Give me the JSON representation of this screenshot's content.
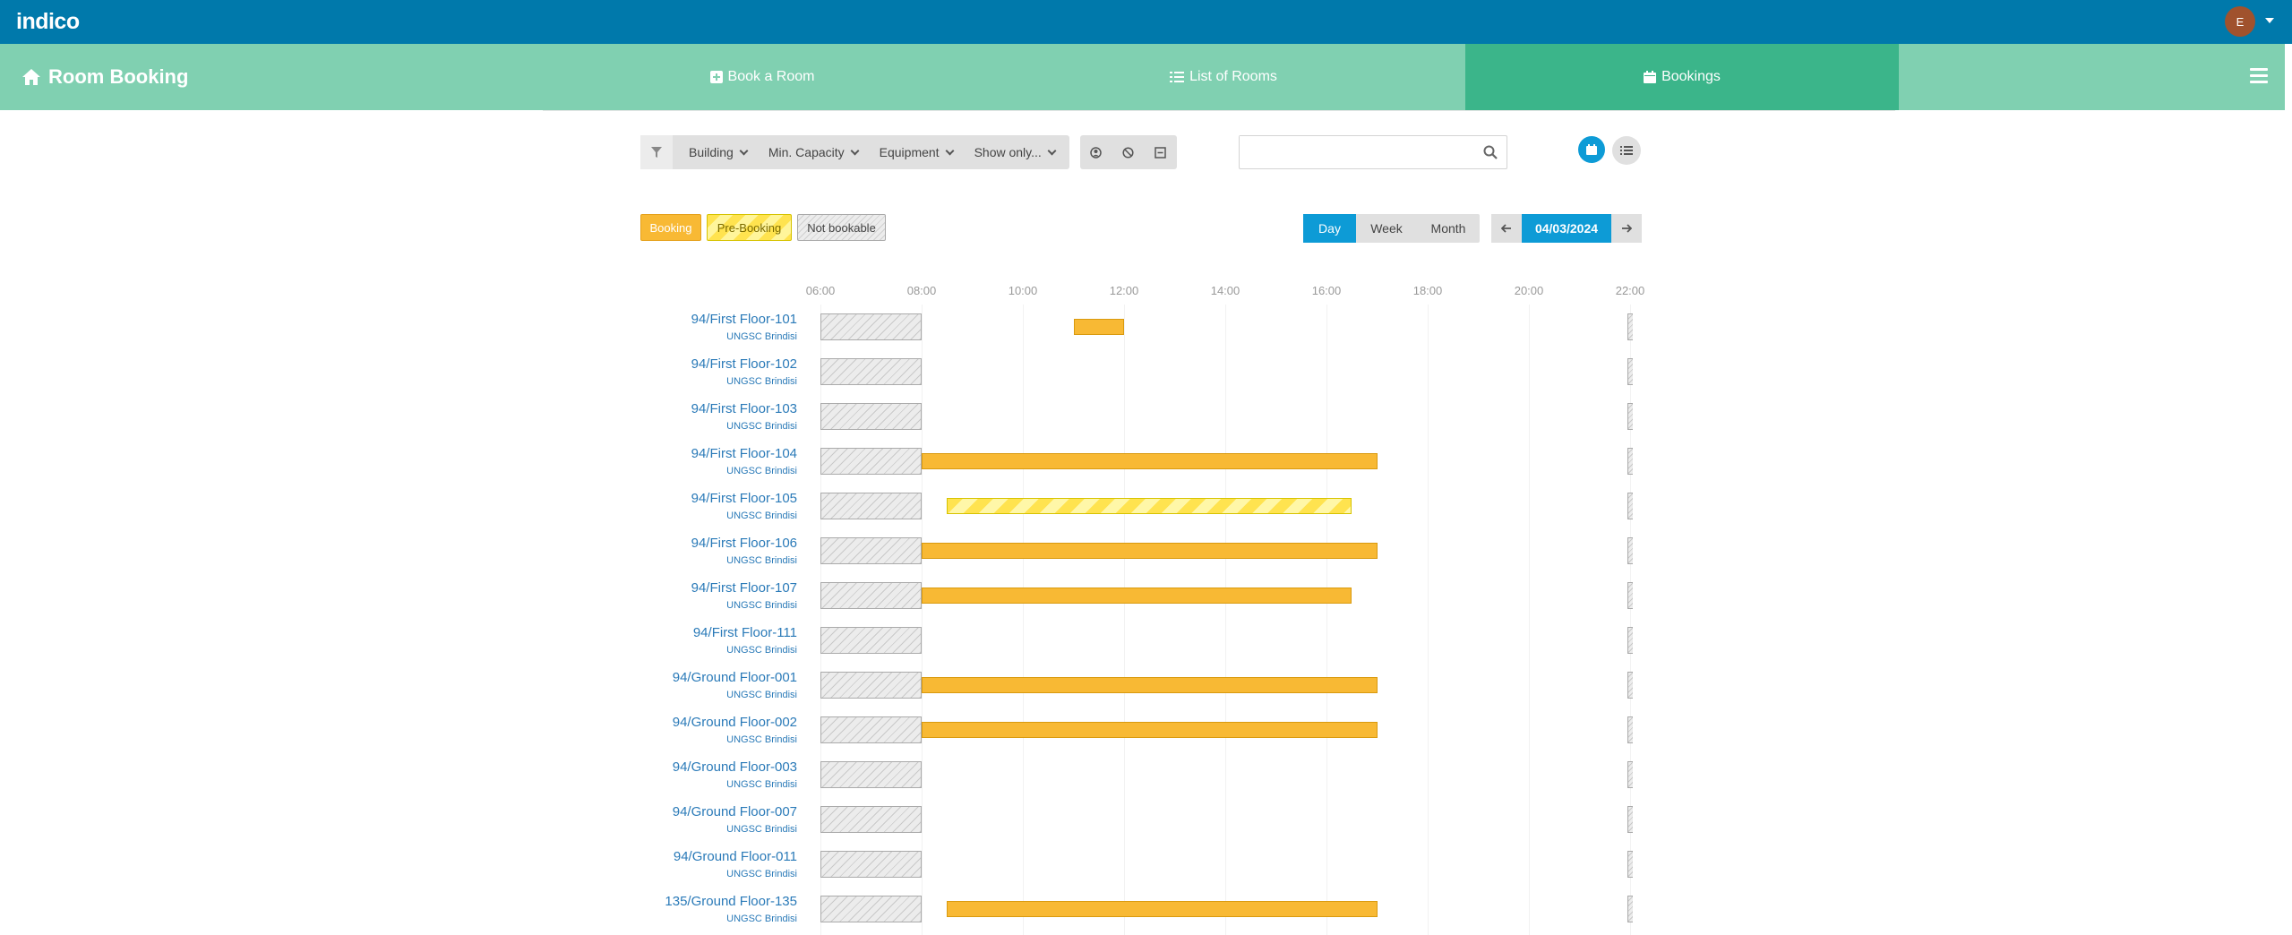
{
  "topbar": {
    "logo_text": "indico",
    "avatar_initial": "E"
  },
  "nav": {
    "title": "Room Booking",
    "items": [
      {
        "label": "Book a Room",
        "icon": "plus-square-icon"
      },
      {
        "label": "List of Rooms",
        "icon": "list-icon"
      },
      {
        "label": "Bookings",
        "icon": "calendar-icon",
        "active": true
      }
    ]
  },
  "filters": {
    "building": "Building",
    "capacity": "Min. Capacity",
    "equipment": "Equipment",
    "show_only": "Show only...",
    "search_placeholder": ""
  },
  "legend": {
    "booking": "Booking",
    "pre_booking": "Pre-Booking",
    "not_bookable": "Not bookable"
  },
  "date_controls": {
    "day": "Day",
    "week": "Week",
    "month": "Month",
    "active_mode": "Day",
    "date": "04/03/2024"
  },
  "timeline": {
    "hours": [
      "06:00",
      "08:00",
      "10:00",
      "12:00",
      "14:00",
      "16:00",
      "18:00",
      "20:00",
      "22:00"
    ],
    "rooms": [
      {
        "name": "94/First Floor-101",
        "building": "UNGSC Brindisi",
        "bookings": [
          {
            "start": "11:00",
            "end": "12:00",
            "type": "booking"
          }
        ]
      },
      {
        "name": "94/First Floor-102",
        "building": "UNGSC Brindisi",
        "bookings": []
      },
      {
        "name": "94/First Floor-103",
        "building": "UNGSC Brindisi",
        "bookings": []
      },
      {
        "name": "94/First Floor-104",
        "building": "UNGSC Brindisi",
        "bookings": [
          {
            "start": "08:00",
            "end": "17:00",
            "type": "booking"
          }
        ]
      },
      {
        "name": "94/First Floor-105",
        "building": "UNGSC Brindisi",
        "bookings": [
          {
            "start": "08:30",
            "end": "16:30",
            "type": "pre-booking"
          }
        ]
      },
      {
        "name": "94/First Floor-106",
        "building": "UNGSC Brindisi",
        "bookings": [
          {
            "start": "08:00",
            "end": "17:00",
            "type": "booking"
          }
        ]
      },
      {
        "name": "94/First Floor-107",
        "building": "UNGSC Brindisi",
        "bookings": [
          {
            "start": "08:00",
            "end": "16:30",
            "type": "booking"
          }
        ]
      },
      {
        "name": "94/First Floor-111",
        "building": "UNGSC Brindisi",
        "bookings": []
      },
      {
        "name": "94/Ground Floor-001",
        "building": "UNGSC Brindisi",
        "bookings": [
          {
            "start": "08:00",
            "end": "17:00",
            "type": "booking"
          }
        ]
      },
      {
        "name": "94/Ground Floor-002",
        "building": "UNGSC Brindisi",
        "bookings": [
          {
            "start": "08:00",
            "end": "17:00",
            "type": "booking"
          }
        ]
      },
      {
        "name": "94/Ground Floor-003",
        "building": "UNGSC Brindisi",
        "bookings": []
      },
      {
        "name": "94/Ground Floor-007",
        "building": "UNGSC Brindisi",
        "bookings": []
      },
      {
        "name": "94/Ground Floor-011",
        "building": "UNGSC Brindisi",
        "bookings": []
      },
      {
        "name": "135/Ground Floor-135",
        "building": "UNGSC Brindisi",
        "bookings": [
          {
            "start": "08:30",
            "end": "17:00",
            "type": "booking"
          }
        ]
      }
    ]
  },
  "colors": {
    "topbar": "#0079ab",
    "nav": "#80d0b1",
    "nav_active": "#3bb58a",
    "accent": "#0d9bd6",
    "booking": "#f8b934",
    "pre_booking": "#ffe34f"
  }
}
